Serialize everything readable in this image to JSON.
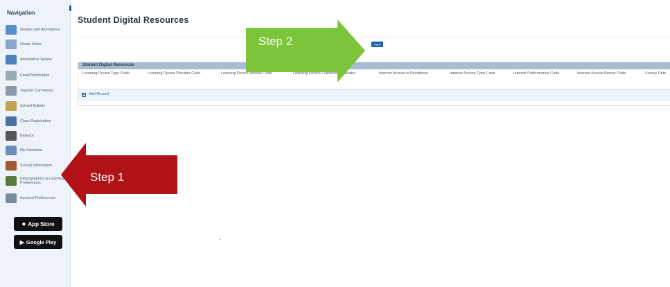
{
  "sidebar": {
    "title": "Navigation",
    "items": [
      {
        "label": "Grades and Attendance",
        "icon": "grades-icon",
        "color": "#5c8fc9"
      },
      {
        "label": "Grade Notes",
        "icon": "notes-icon",
        "color": "#8aa6c6"
      },
      {
        "label": "Attendance History",
        "icon": "attendance-icon",
        "color": "#4d7fbf"
      },
      {
        "label": "Email Notification",
        "icon": "email-icon",
        "color": "#9aa8b8"
      },
      {
        "label": "Teacher Comments",
        "icon": "comments-icon",
        "color": "#8899aa"
      },
      {
        "label": "School Bulletin",
        "icon": "bulletin-icon",
        "color": "#c4a050"
      },
      {
        "label": "Class Registration",
        "icon": "registration-icon",
        "color": "#4a6fa0"
      },
      {
        "label": "Balance",
        "icon": "balance-icon",
        "color": "#555555"
      },
      {
        "label": "My Schedule",
        "icon": "schedule-icon",
        "color": "#6b8cb5"
      },
      {
        "label": "School Information",
        "icon": "school-icon",
        "color": "#a05a30"
      },
      {
        "label": "Demographics & Learning Preferences",
        "icon": "demographics-icon",
        "color": "#5a7a3a"
      },
      {
        "label": "Account Preferences",
        "icon": "account-icon",
        "color": "#7a8c9e"
      }
    ],
    "app_store": "App Store",
    "google_play": "Google Play"
  },
  "main": {
    "title": "Student Digital Resources",
    "print_label": "Print",
    "panel_title": "Student Digital Resources",
    "columns": [
      "Learning Device Type Code",
      "Learning Device Provider Code",
      "Learning Device Access Code",
      "Learning Device Fullfillment Indicator",
      "Internet Access in Residence",
      "Internet Access Type Code",
      "Internet Performance Code",
      "Internet Access Barrier Code",
      "Survey Date"
    ],
    "add_label": "Add Record"
  },
  "callouts": {
    "step1": "Step 1",
    "step2": "Step 2"
  },
  "colors": {
    "step1_arrow": "#b01217",
    "step2_arrow": "#7cc53a",
    "accent": "#1f68b5",
    "panel_header": "#a9bdd2"
  }
}
